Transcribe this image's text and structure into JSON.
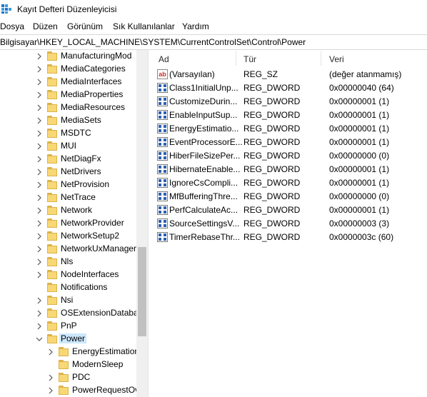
{
  "window": {
    "title": "Kayıt Defteri Düzenleyicisi"
  },
  "menu": [
    "Dosya",
    "Düzen",
    "Görünüm",
    "Sık Kullanılanlar",
    "Yardım"
  ],
  "address": "Bilgisayar\\HKEY_LOCAL_MACHINE\\SYSTEM\\CurrentControlSet\\Control\\Power",
  "tree": {
    "items": [
      {
        "label": "ManufacturingMod",
        "level": 1,
        "expander": "collapsed"
      },
      {
        "label": "MediaCategories",
        "level": 1,
        "expander": "collapsed"
      },
      {
        "label": "MediaInterfaces",
        "level": 1,
        "expander": "collapsed"
      },
      {
        "label": "MediaProperties",
        "level": 1,
        "expander": "collapsed"
      },
      {
        "label": "MediaResources",
        "level": 1,
        "expander": "collapsed"
      },
      {
        "label": "MediaSets",
        "level": 1,
        "expander": "collapsed"
      },
      {
        "label": "MSDTC",
        "level": 1,
        "expander": "collapsed"
      },
      {
        "label": "MUI",
        "level": 1,
        "expander": "collapsed"
      },
      {
        "label": "NetDiagFx",
        "level": 1,
        "expander": "collapsed"
      },
      {
        "label": "NetDrivers",
        "level": 1,
        "expander": "collapsed"
      },
      {
        "label": "NetProvision",
        "level": 1,
        "expander": "collapsed"
      },
      {
        "label": "NetTrace",
        "level": 1,
        "expander": "collapsed"
      },
      {
        "label": "Network",
        "level": 1,
        "expander": "collapsed"
      },
      {
        "label": "NetworkProvider",
        "level": 1,
        "expander": "collapsed"
      },
      {
        "label": "NetworkSetup2",
        "level": 1,
        "expander": "collapsed"
      },
      {
        "label": "NetworkUxManager",
        "level": 1,
        "expander": "collapsed"
      },
      {
        "label": "Nls",
        "level": 1,
        "expander": "collapsed"
      },
      {
        "label": "NodeInterfaces",
        "level": 1,
        "expander": "collapsed"
      },
      {
        "label": "Notifications",
        "level": 1,
        "expander": "none"
      },
      {
        "label": "Nsi",
        "level": 1,
        "expander": "collapsed"
      },
      {
        "label": "OSExtensionDatabas",
        "level": 1,
        "expander": "collapsed"
      },
      {
        "label": "PnP",
        "level": 1,
        "expander": "collapsed"
      },
      {
        "label": "Power",
        "level": 1,
        "expander": "expanded",
        "selected": true
      },
      {
        "label": "EnergyEstimation",
        "level": 2,
        "expander": "collapsed"
      },
      {
        "label": "ModernSleep",
        "level": 2,
        "expander": "none"
      },
      {
        "label": "PDC",
        "level": 2,
        "expander": "collapsed"
      },
      {
        "label": "PowerRequestOv",
        "level": 2,
        "expander": "collapsed"
      }
    ]
  },
  "list": {
    "headers": {
      "name": "Ad",
      "type": "Tür",
      "data": "Veri"
    },
    "rows": [
      {
        "name": "(Varsayılan)",
        "type": "REG_SZ",
        "data": "(değer atanmamış)",
        "icon": "string-value-icon"
      },
      {
        "name": "Class1InitialUnp...",
        "type": "REG_DWORD",
        "data": "0x00000040 (64)",
        "icon": "binary-value-icon"
      },
      {
        "name": "CustomizeDurin...",
        "type": "REG_DWORD",
        "data": "0x00000001 (1)",
        "icon": "binary-value-icon"
      },
      {
        "name": "EnableInputSup...",
        "type": "REG_DWORD",
        "data": "0x00000001 (1)",
        "icon": "binary-value-icon"
      },
      {
        "name": "EnergyEstimatio...",
        "type": "REG_DWORD",
        "data": "0x00000001 (1)",
        "icon": "binary-value-icon"
      },
      {
        "name": "EventProcessorE...",
        "type": "REG_DWORD",
        "data": "0x00000001 (1)",
        "icon": "binary-value-icon"
      },
      {
        "name": "HiberFileSizePer...",
        "type": "REG_DWORD",
        "data": "0x00000000 (0)",
        "icon": "binary-value-icon"
      },
      {
        "name": "HibernateEnable...",
        "type": "REG_DWORD",
        "data": "0x00000001 (1)",
        "icon": "binary-value-icon"
      },
      {
        "name": "IgnoreCsCompli...",
        "type": "REG_DWORD",
        "data": "0x00000001 (1)",
        "icon": "binary-value-icon"
      },
      {
        "name": "MfBufferingThre...",
        "type": "REG_DWORD",
        "data": "0x00000000 (0)",
        "icon": "binary-value-icon"
      },
      {
        "name": "PerfCalculateAc...",
        "type": "REG_DWORD",
        "data": "0x00000001 (1)",
        "icon": "binary-value-icon"
      },
      {
        "name": "SourceSettingsV...",
        "type": "REG_DWORD",
        "data": "0x00000003 (3)",
        "icon": "binary-value-icon"
      },
      {
        "name": "TimerRebaseThr...",
        "type": "REG_DWORD",
        "data": "0x0000003c (60)",
        "icon": "binary-value-icon"
      }
    ]
  },
  "colors": {
    "selection": "#cce8ff",
    "folder": "#f8d775",
    "scrollbar_thumb": "#c1c1c1"
  }
}
